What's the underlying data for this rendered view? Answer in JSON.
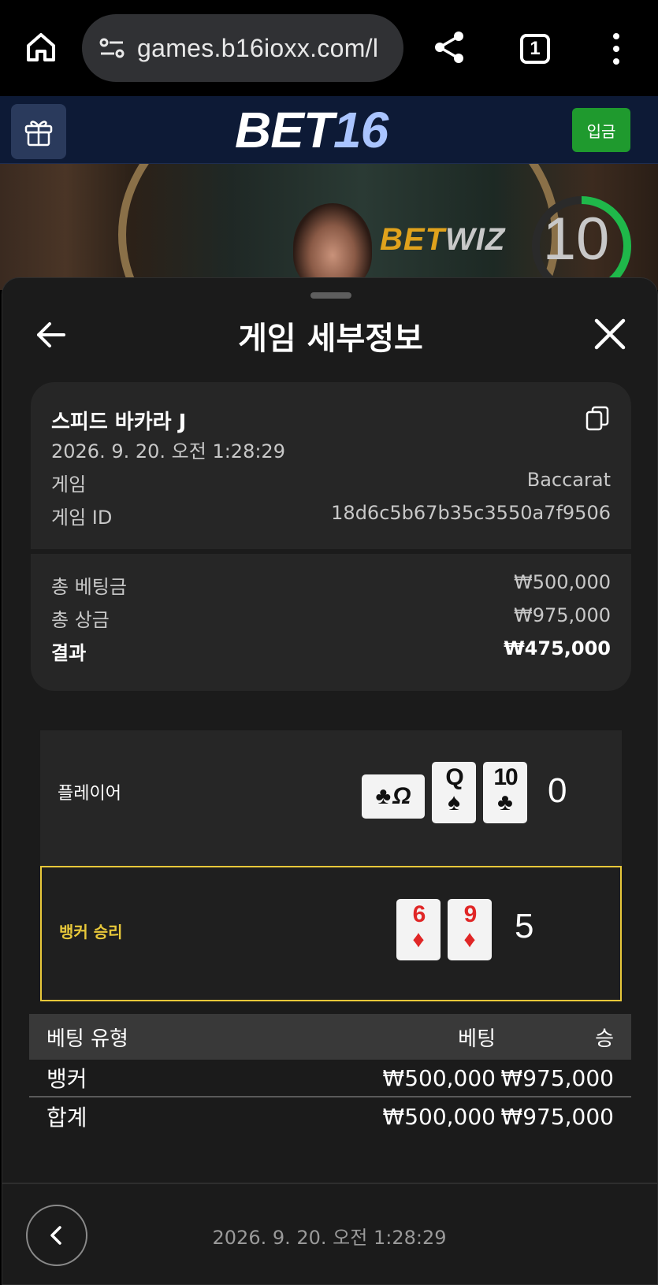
{
  "browser": {
    "url": "games.b16ioxx.com/l",
    "tab_count": "1"
  },
  "site": {
    "logo_main": "BET",
    "logo_num": "16",
    "deposit_label": "입금"
  },
  "video": {
    "provider_a": "BET",
    "provider_b": "WIZ",
    "countdown": "10"
  },
  "sheet": {
    "title": "게임 세부정보"
  },
  "info": {
    "game_name": "스피드 바카라 J",
    "datetime": "2026. 9. 20. 오전 1:28:29",
    "game_label": "게임",
    "game_value": "Baccarat",
    "game_id_label": "게임 ID",
    "game_id_value": "18d6c5b67b35c3550a7f9506",
    "total_bet_label": "총 베팅금",
    "total_bet_value": "₩500,000",
    "total_prize_label": "총 상금",
    "total_prize_value": "₩975,000",
    "result_label": "결과",
    "result_value": "₩475,000"
  },
  "board": {
    "player": {
      "label": "플레이어",
      "score": "0",
      "cards": [
        {
          "rank": "Q",
          "suit": "♠"
        },
        {
          "rank": "10",
          "suit": "♣"
        }
      ],
      "third_card": {
        "rank": "Q",
        "suit": "♣",
        "orientation": "sideways"
      }
    },
    "banker": {
      "label": "뱅커 승리",
      "score": "5",
      "cards": [
        {
          "rank": "6",
          "suit": "♦"
        },
        {
          "rank": "9",
          "suit": "♦"
        }
      ]
    }
  },
  "bets": {
    "headers": [
      "베팅 유형",
      "베팅",
      "승"
    ],
    "rows": [
      [
        "뱅커",
        "₩500,000",
        "₩975,000"
      ],
      [
        "합계",
        "₩500,000",
        "₩975,000"
      ]
    ]
  },
  "footer": {
    "datetime": "2026. 9. 20. 오전 1:28:29"
  },
  "colors": {
    "header_bg": "#0d1a36",
    "deposit_green": "#1f9a2e",
    "banker_highlight": "#e8c83a",
    "sheet_bg": "#1b1b1b",
    "card_bg": "#262626",
    "red_suit": "#e02626"
  }
}
